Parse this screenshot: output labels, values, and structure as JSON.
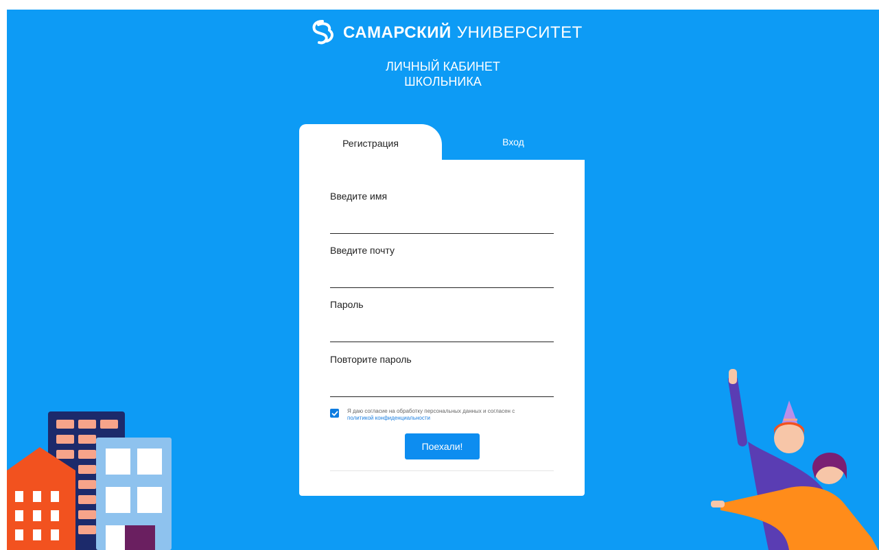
{
  "brand": {
    "name_bold": "САМАРСКИЙ",
    "name_light": "УНИВЕРСИТЕТ"
  },
  "header": {
    "line1": "ЛИЧНЫЙ КАБИНЕТ",
    "line2": "ШКОЛЬНИКА"
  },
  "tabs": {
    "register": "Регистрация",
    "login": "Вход"
  },
  "form": {
    "name_label": "Введите имя",
    "email_label": "Введите почту",
    "password_label": "Пароль",
    "repeat_password_label": "Повторите пароль",
    "name_value": "",
    "email_value": "",
    "password_value": "",
    "repeat_password_value": "",
    "consent_text": "Я даю согласие на обработку персональных данных и согласен с",
    "consent_link": "политикой конфиденциальности",
    "consent_checked": true,
    "submit_label": "Поехали!"
  },
  "colors": {
    "background": "#0d9bf5",
    "button": "#0d8df0",
    "checkbox": "#0d7ce0",
    "link": "#1a7ee0"
  },
  "icons": {
    "logo": "samara-university-logo-icon",
    "check": "check-icon"
  }
}
